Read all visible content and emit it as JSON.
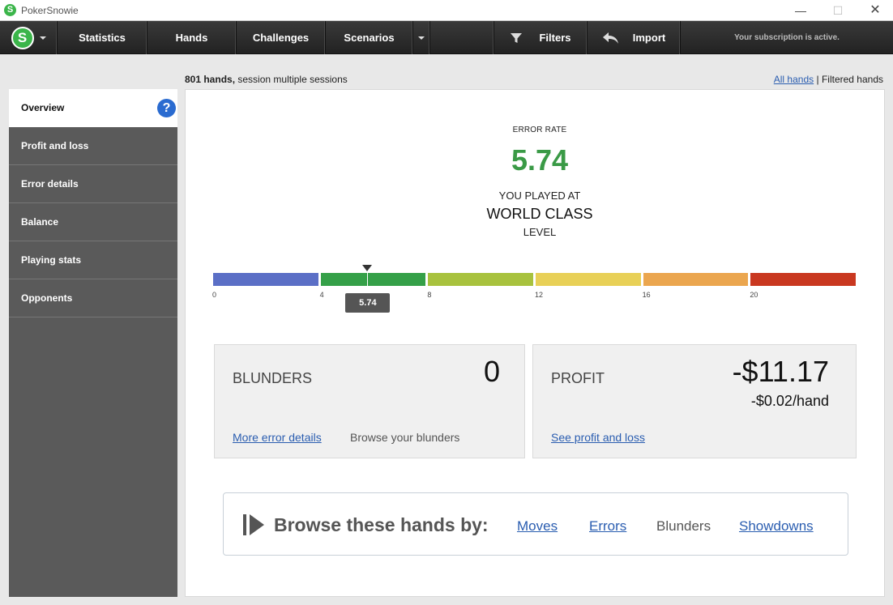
{
  "window": {
    "title": "PokerSnowie",
    "logo_letter": "S",
    "min": "—",
    "max": "☐",
    "close": "✕"
  },
  "nav": {
    "logo_letter": "S",
    "items": [
      "Statistics",
      "Hands",
      "Challenges",
      "Scenarios"
    ],
    "filters": "Filters",
    "import": "Import",
    "subscription": "Your subscription is active."
  },
  "header": {
    "hands_count": "801 hands,",
    "session": "session multiple sessions",
    "all_hands": "All hands",
    "separator": "|",
    "filtered_hands": "Filtered hands"
  },
  "sidebar": {
    "items": [
      {
        "label": "Overview",
        "active": true
      },
      {
        "label": "Profit and loss"
      },
      {
        "label": "Error details"
      },
      {
        "label": "Balance"
      },
      {
        "label": "Playing stats"
      },
      {
        "label": "Opponents"
      }
    ],
    "help": "?"
  },
  "overview": {
    "error_rate_label": "ERROR RATE",
    "error_rate_value": "5.74",
    "played_at": "YOU PLAYED AT",
    "level_name": "WORLD CLASS",
    "level_word": "LEVEL",
    "scale": {
      "ticks": [
        "0",
        "4",
        "8",
        "12",
        "16",
        "20"
      ],
      "segment_colors": [
        "#5b6fc6",
        "#35a048",
        "#a8c23e",
        "#e8d057",
        "#eba64f",
        "#c93820"
      ],
      "marker_value": 5.74,
      "marker_label": "5.74",
      "max": 24
    },
    "blunders": {
      "title": "BLUNDERS",
      "count": "0",
      "link": "More error details",
      "text": "Browse your blunders"
    },
    "profit": {
      "title": "PROFIT",
      "total": "-$11.17",
      "per_hand": "-$0.02/hand",
      "link": "See profit and loss"
    },
    "browse": {
      "label": "Browse these hands by:",
      "options": [
        "Moves",
        "Errors",
        "Blunders",
        "Showdowns"
      ]
    }
  }
}
